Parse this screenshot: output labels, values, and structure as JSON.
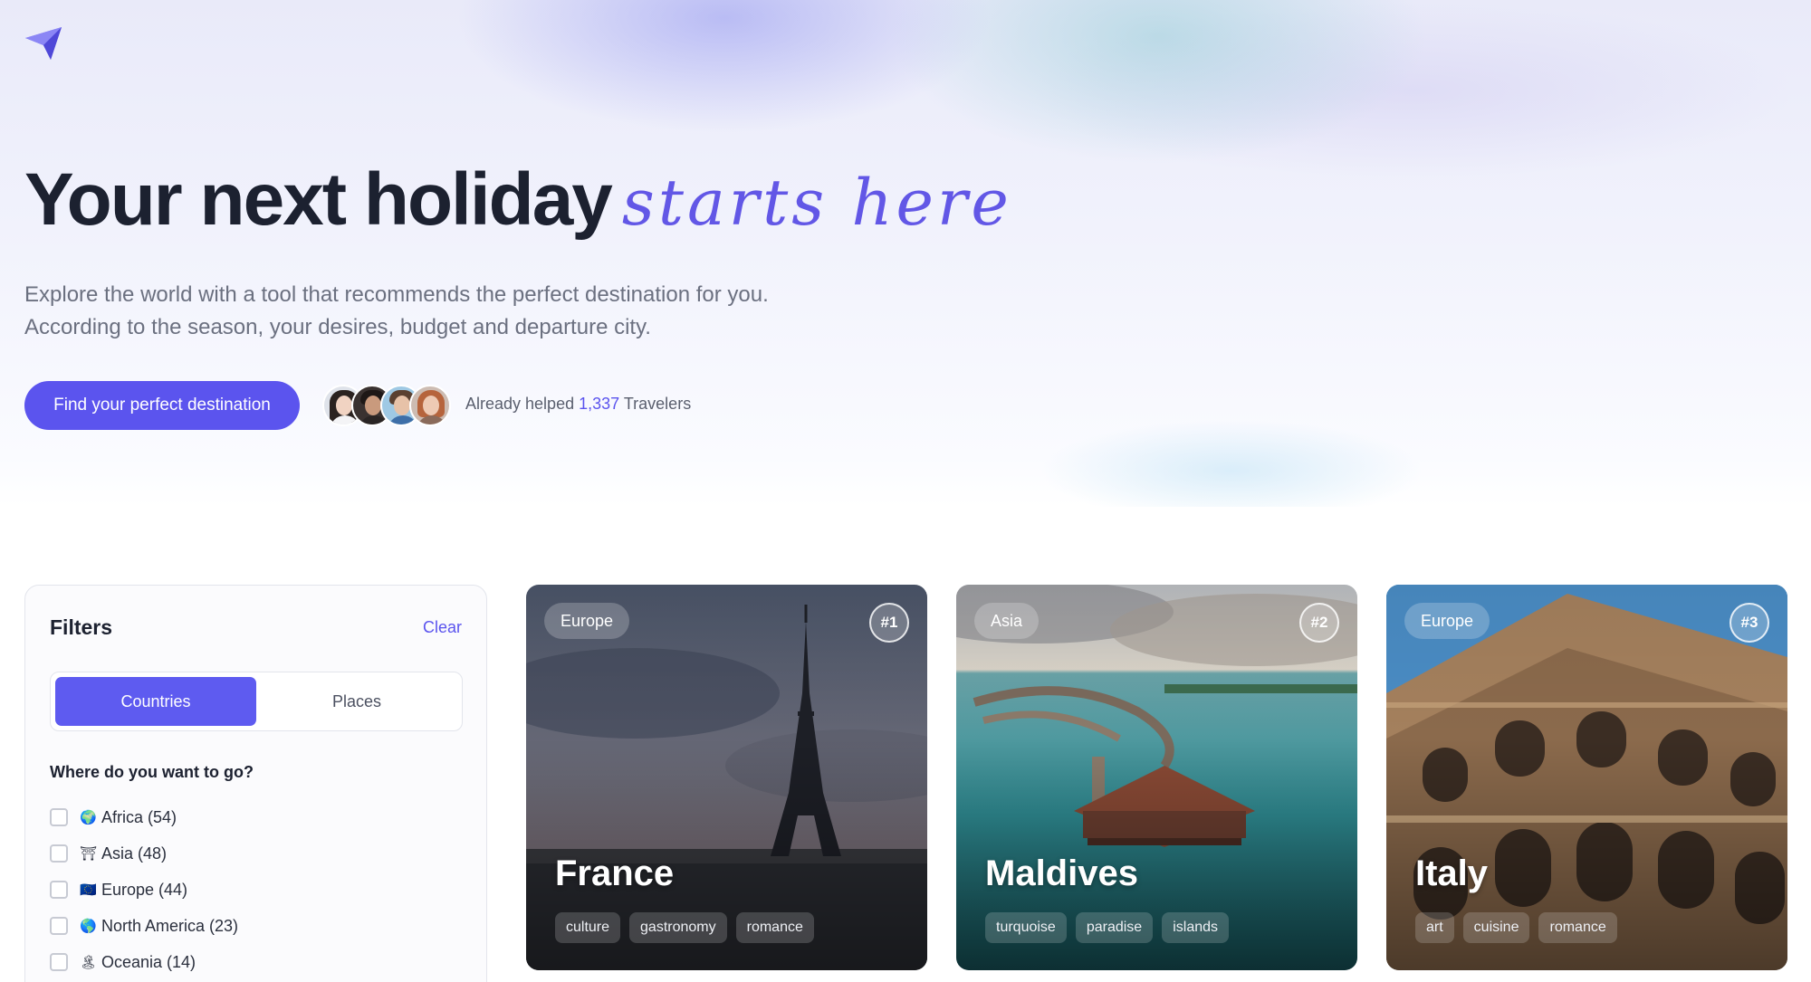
{
  "hero": {
    "headline_main": "Your next holiday",
    "headline_script": "starts here",
    "subtitle_line1": "Explore the world with a tool that recommends the perfect destination for you.",
    "subtitle_line2": "According to the season, your desires, budget and departure city.",
    "cta_label": "Find your perfect destination",
    "helped_prefix": "Already helped",
    "helped_count": "1,337",
    "helped_suffix": "Travelers"
  },
  "colors": {
    "accent": "#5b54ee",
    "headline": "#1c2130"
  },
  "filters": {
    "title": "Filters",
    "clear_label": "Clear",
    "tabs": [
      {
        "label": "Countries",
        "active": true
      },
      {
        "label": "Places",
        "active": false
      }
    ],
    "question": "Where do you want to go?",
    "regions": [
      {
        "icon": "🌍",
        "label": "Africa (54)",
        "checked": false
      },
      {
        "icon": "⛩",
        "label": "Asia (48)",
        "checked": false
      },
      {
        "icon": "🇪🇺",
        "label": "Europe (44)",
        "checked": false
      },
      {
        "icon": "🌎",
        "label": "North America (23)",
        "checked": false
      },
      {
        "icon": "🏝",
        "label": "Oceania (14)",
        "checked": false
      }
    ]
  },
  "cards": [
    {
      "region": "Europe",
      "rank": "#1",
      "name": "France",
      "tags": [
        "culture",
        "gastronomy",
        "romance"
      ],
      "image": "eiffel-tower"
    },
    {
      "region": "Asia",
      "rank": "#2",
      "name": "Maldives",
      "tags": [
        "turquoise",
        "paradise",
        "islands"
      ],
      "image": "overwater-villas"
    },
    {
      "region": "Europe",
      "rank": "#3",
      "name": "Italy",
      "tags": [
        "art",
        "cuisine",
        "romance"
      ],
      "image": "colosseum"
    }
  ]
}
